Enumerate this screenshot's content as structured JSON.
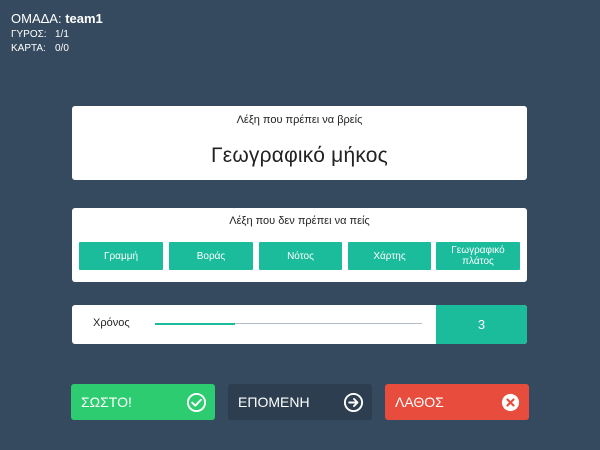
{
  "status": {
    "team_label": "ΟΜΑΔΑ:",
    "team_name": "team1",
    "round_label": "ΓΥΡΟΣ:",
    "round_value": "1/1",
    "card_label": "ΚΑΡΤΑ:",
    "card_value": "0/0"
  },
  "target": {
    "caption": "Λέξη που πρέπει να βρείς",
    "word": "Γεωγραφικό μήκος"
  },
  "taboo": {
    "caption": "Λέξη που δεν πρέπει να πείς",
    "words": [
      "Γραμμή",
      "Βοράς",
      "Νότος",
      "Χάρτης",
      "Γεωγραφικό πλάτος"
    ]
  },
  "timer": {
    "label": "Χρόνος",
    "remaining_fraction": 0.3,
    "count": "3"
  },
  "actions": {
    "correct_label": "ΣΩΣΤΟ!",
    "correct_icon": "check-circle-icon",
    "next_label": "ΕΠΟΜΕΝΗ",
    "next_icon": "arrow-circle-right-icon",
    "wrong_label": "ΛΑΘΟΣ",
    "wrong_icon": "x-circle-icon"
  },
  "colors": {
    "background": "#354a5f",
    "accent": "#1abc9c",
    "correct": "#2ecc71",
    "next": "#2c3e50",
    "wrong": "#e74c3c"
  }
}
